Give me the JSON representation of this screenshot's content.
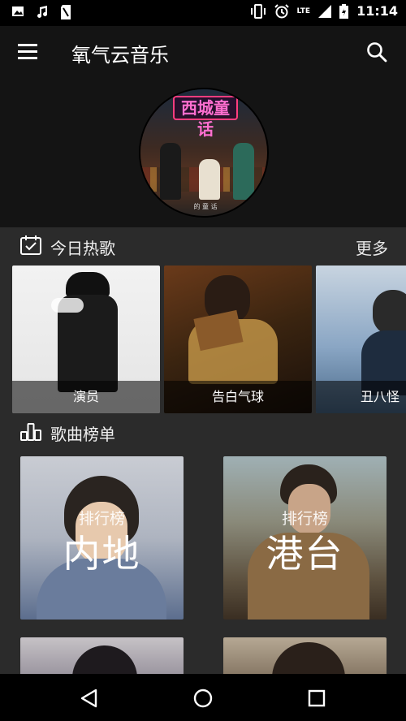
{
  "status_bar": {
    "time": "11:14",
    "network": "LTE",
    "left_icons": [
      "image-icon",
      "music-note-icon",
      "sd-card-icon"
    ],
    "right_icons": [
      "vibrate-icon",
      "alarm-icon",
      "signal-icon",
      "battery-icon"
    ]
  },
  "app_bar": {
    "title": "氧气云音乐",
    "menu_icon": "hamburger-menu-icon",
    "search_icon": "search-icon"
  },
  "hero": {
    "album_sign": "西城童话",
    "caption": "的 童 话"
  },
  "hot_songs": {
    "title": "今日热歌",
    "more_label": "更多",
    "icon": "calendar-check-icon",
    "items": [
      {
        "label": "演员"
      },
      {
        "label": "告白气球"
      },
      {
        "label": "丑八怪（《"
      }
    ]
  },
  "charts": {
    "title": "歌曲榜单",
    "icon": "bar-chart-icon",
    "items": [
      {
        "subtitle": "排行榜",
        "name": "内地"
      },
      {
        "subtitle": "排行榜",
        "name": "港台"
      },
      {
        "subtitle": "",
        "name": ""
      },
      {
        "subtitle": "",
        "name": ""
      }
    ]
  },
  "nav_bar": {
    "icons": [
      "back-triangle-icon",
      "home-circle-icon",
      "recents-square-icon"
    ]
  },
  "colors": {
    "background": "#2b2b2b",
    "app_bar": "#141414",
    "status_bar": "#000000",
    "text": "#ffffff"
  }
}
